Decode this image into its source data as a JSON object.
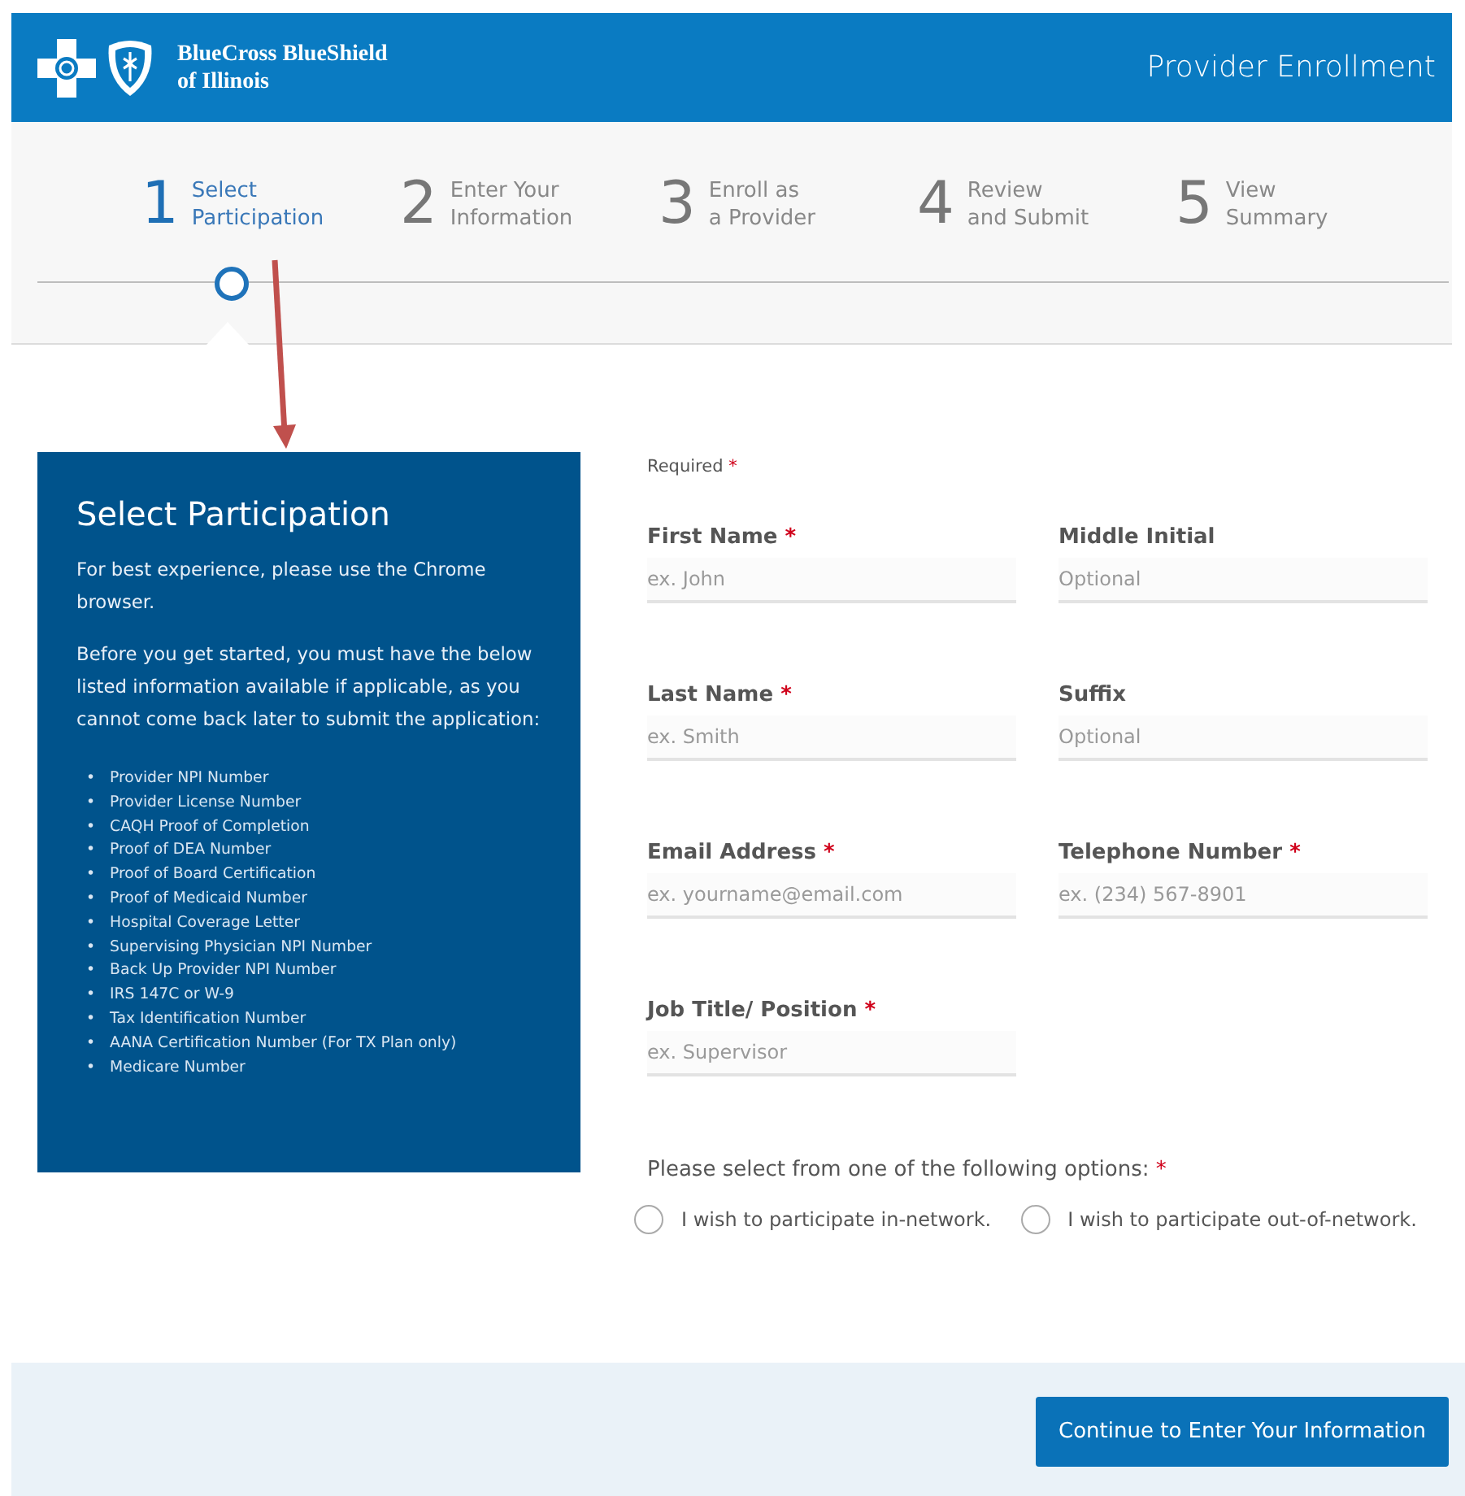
{
  "header": {
    "brand_lines": [
      "BlueCross BlueShield",
      "of Illinois"
    ],
    "title": "Provider Enrollment"
  },
  "steps": [
    {
      "number": "1",
      "lines": [
        "Select",
        "Participation"
      ],
      "selected": true
    },
    {
      "number": "2",
      "lines": [
        "Enter Your",
        "Information"
      ],
      "selected": false
    },
    {
      "number": "3",
      "lines": [
        "Enroll as",
        "a Provider"
      ],
      "selected": false
    },
    {
      "number": "4",
      "lines": [
        "Review",
        "and Submit"
      ],
      "selected": false
    },
    {
      "number": "5",
      "lines": [
        "View",
        "Summary"
      ],
      "selected": false
    }
  ],
  "info_panel": {
    "title": "Select Participation",
    "paragraphs": [
      "For best experience, please use the Chrome browser.",
      "Before you get started, you must have the below listed information available if applicable, as you cannot come back later to submit the application:"
    ],
    "bullet": "•",
    "items": [
      "Provider NPI Number",
      "Provider License Number",
      "CAQH Proof of Completion",
      "Proof of DEA Number",
      "Proof of Board Certification",
      "Proof of Medicaid Number",
      "Hospital Coverage Letter",
      "Supervising Physician NPI Number",
      "Back Up Provider NPI Number",
      "IRS 147C or W-9",
      "Tax Identification Number",
      "AANA Certification Number (For TX Plan only)",
      "Medicare Number"
    ]
  },
  "form": {
    "required_note": {
      "text": "Required",
      "mark": "*"
    },
    "fields": [
      {
        "label": "First Name",
        "mark": "*",
        "placeholder": "ex. John"
      },
      {
        "label": "Middle Initial",
        "placeholder": "Optional"
      },
      {
        "label": "Last Name",
        "mark": "*",
        "placeholder": "ex. Smith"
      },
      {
        "label": "Suffix",
        "placeholder": "Optional"
      },
      {
        "label": "Email Address",
        "mark": "*",
        "placeholder": "ex. yourname@email.com"
      },
      {
        "label": "Telephone Number",
        "mark": "*",
        "placeholder": "ex. (234) 567-8901"
      },
      {
        "label": "Job Title/ Position",
        "mark": "*",
        "placeholder": "ex. Supervisor"
      }
    ],
    "options_prompt": {
      "text": "Please select from one of the following options:",
      "mark": "*"
    },
    "options": [
      {
        "label": "I wish to participate in-network.",
        "selected": false
      },
      {
        "label": "I wish to participate out-of-network.",
        "selected": false
      }
    ]
  },
  "footer": {
    "button": "Continue to Enter Your Information"
  }
}
